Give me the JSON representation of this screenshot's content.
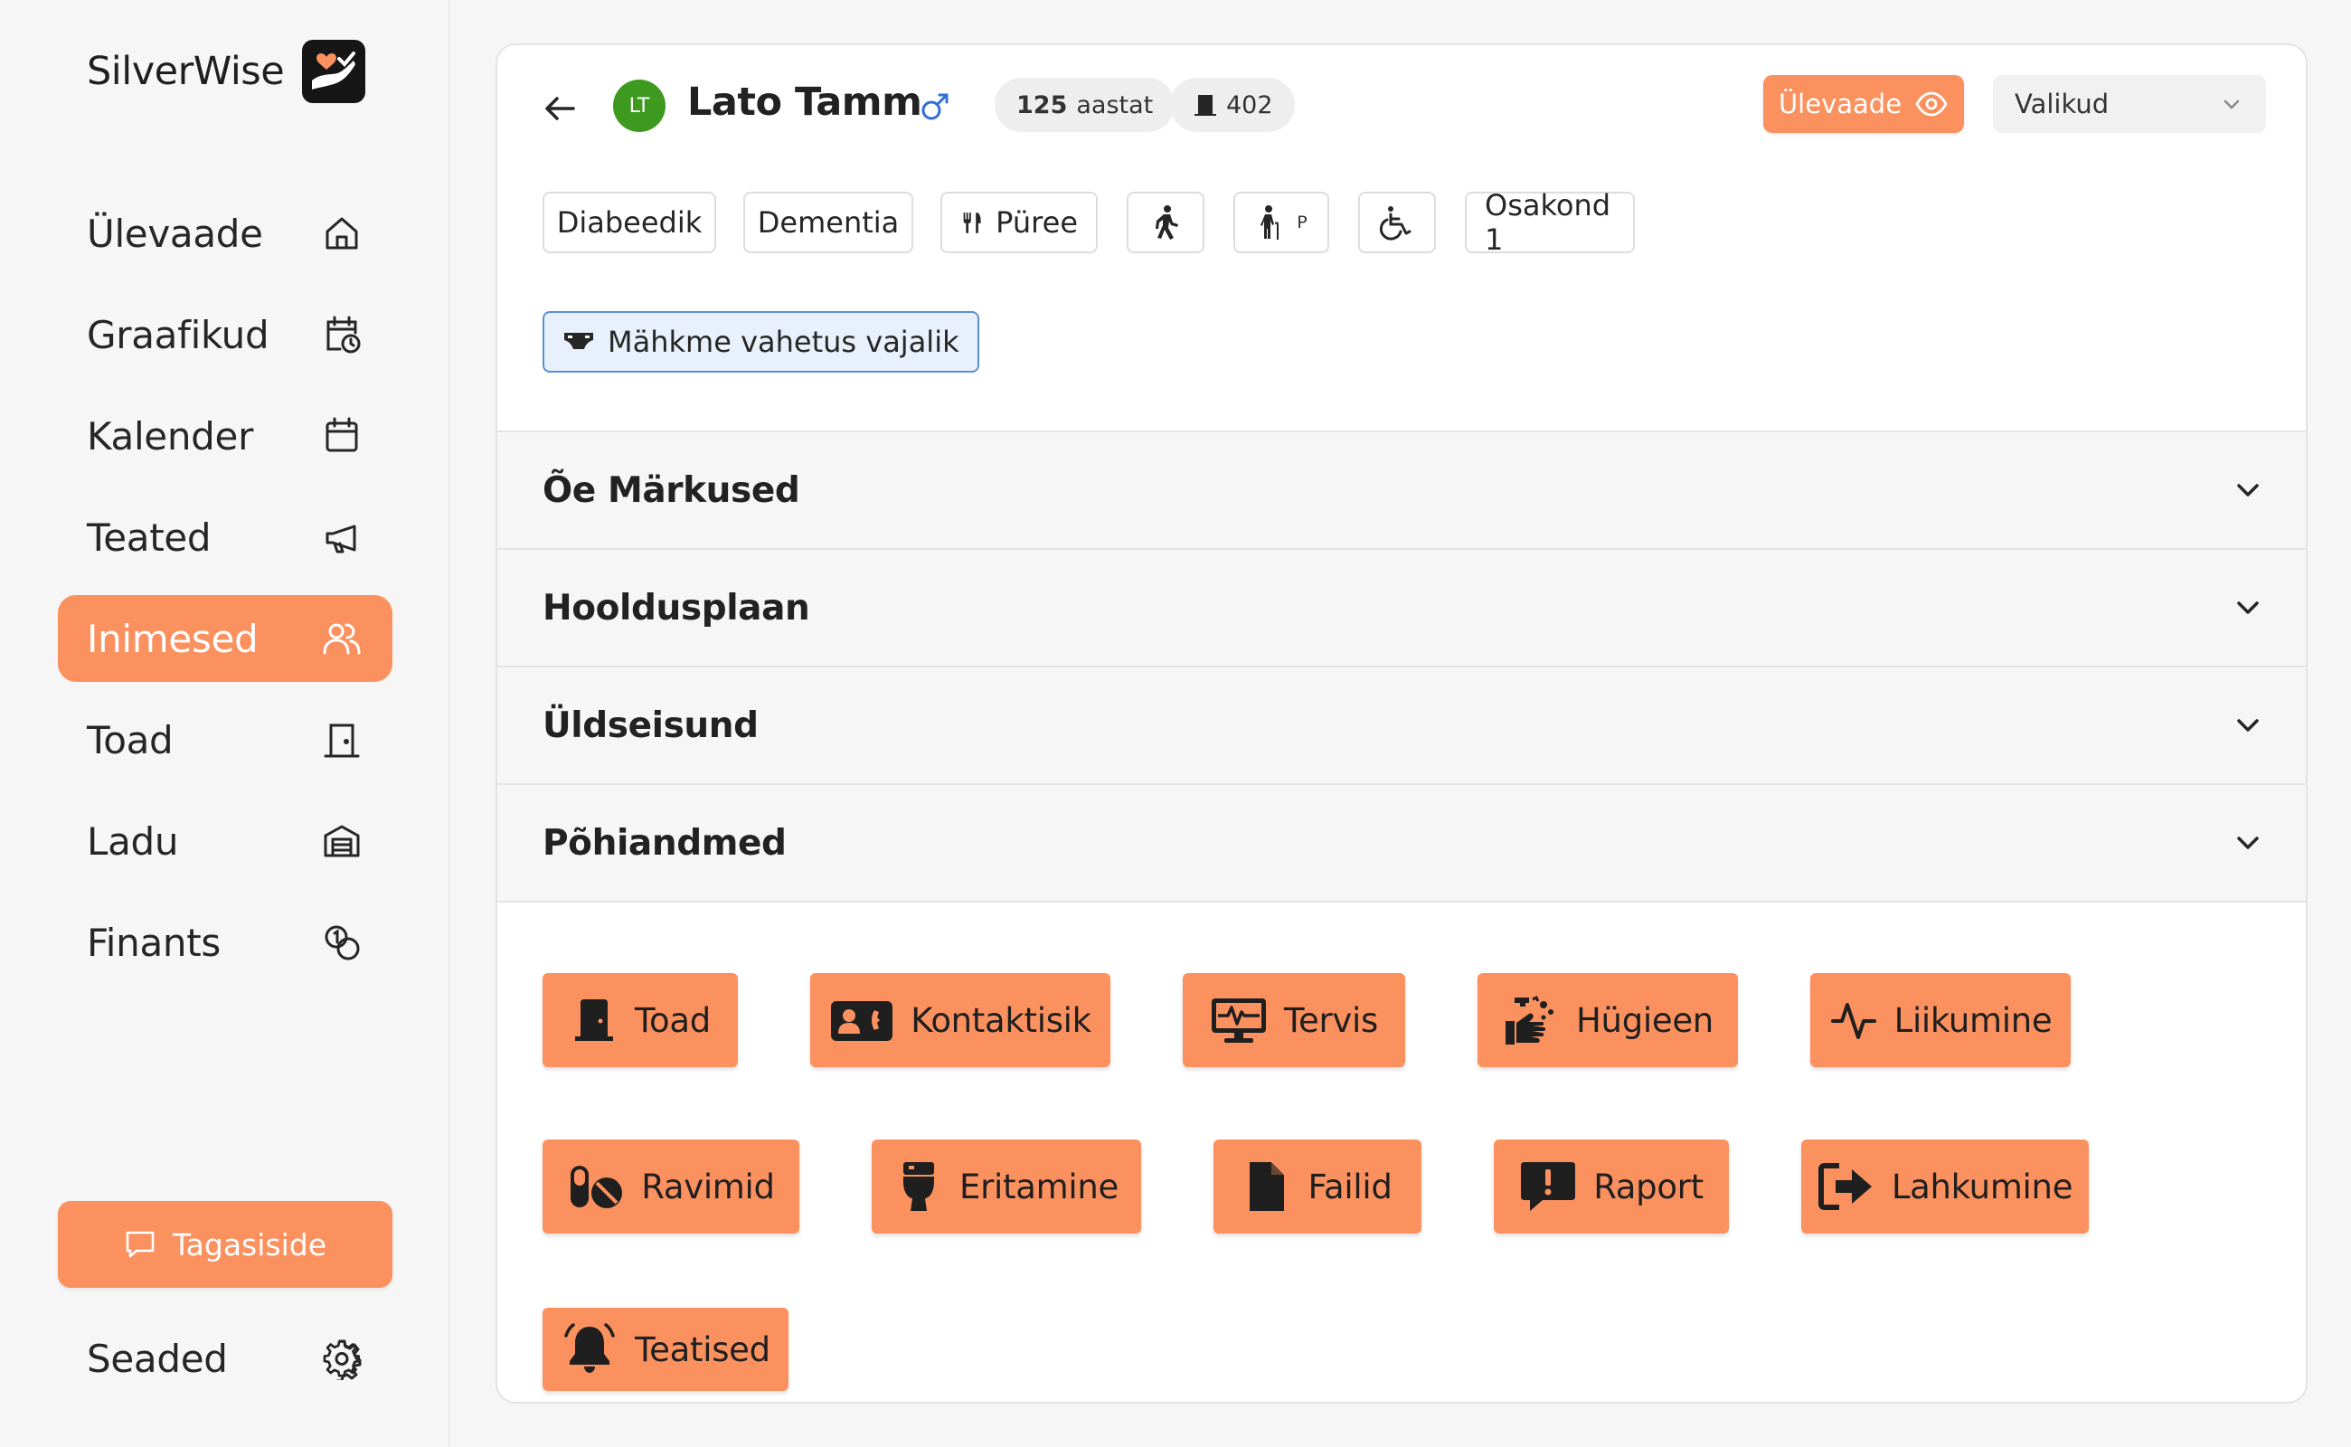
{
  "brand": {
    "name": "SilverWise",
    "logo_icon": "hand-heart-icon"
  },
  "sidebar": {
    "items": [
      {
        "label": "Ülevaade",
        "icon": "home-icon"
      },
      {
        "label": "Graafikud",
        "icon": "calendar-clock-icon"
      },
      {
        "label": "Kalender",
        "icon": "calendar-icon"
      },
      {
        "label": "Teated",
        "icon": "megaphone-icon"
      },
      {
        "label": "Inimesed",
        "icon": "users-icon",
        "active": true
      },
      {
        "label": "Toad",
        "icon": "door-icon"
      },
      {
        "label": "Ladu",
        "icon": "warehouse-icon"
      },
      {
        "label": "Finants",
        "icon": "coins-icon"
      }
    ],
    "feedback_label": "Tagasiside",
    "settings_label": "Seaded"
  },
  "person": {
    "initials": "LT",
    "name": "Lato Tamm",
    "gender_symbol": "♂",
    "age_value": "125",
    "age_unit": "aastat",
    "room": "402"
  },
  "header": {
    "overview_label": "Ülevaade",
    "options_label": "Valikud"
  },
  "tags": {
    "diabetic": "Diabeedik",
    "dementia": "Dementia",
    "diet": "Püree",
    "cane_suffix": "P",
    "ward": "Osakond 1",
    "alert": "Mähkme vahetus vajalik"
  },
  "sections": [
    {
      "title": "Õe Märkused"
    },
    {
      "title": "Hooldusplaan"
    },
    {
      "title": "Üldseisund"
    },
    {
      "title": "Põhiandmed"
    }
  ],
  "actions": [
    {
      "label": "Toad",
      "icon": "door-icon"
    },
    {
      "label": "Kontaktisik",
      "icon": "contact-card-icon"
    },
    {
      "label": "Tervis",
      "icon": "health-monitor-icon"
    },
    {
      "label": "Hügieen",
      "icon": "hand-wash-icon"
    },
    {
      "label": "Liikumine",
      "icon": "activity-icon"
    },
    {
      "label": "Ravimid",
      "icon": "pills-icon"
    },
    {
      "label": "Eritamine",
      "icon": "toilet-icon"
    },
    {
      "label": "Failid",
      "icon": "file-icon"
    },
    {
      "label": "Raport",
      "icon": "report-icon"
    },
    {
      "label": "Lahkumine",
      "icon": "exit-icon"
    },
    {
      "label": "Teatised",
      "icon": "bell-icon"
    }
  ],
  "colors": {
    "accent": "#fb915f",
    "avatar": "#3d9a1f",
    "alert_border": "#5a8fd8"
  }
}
